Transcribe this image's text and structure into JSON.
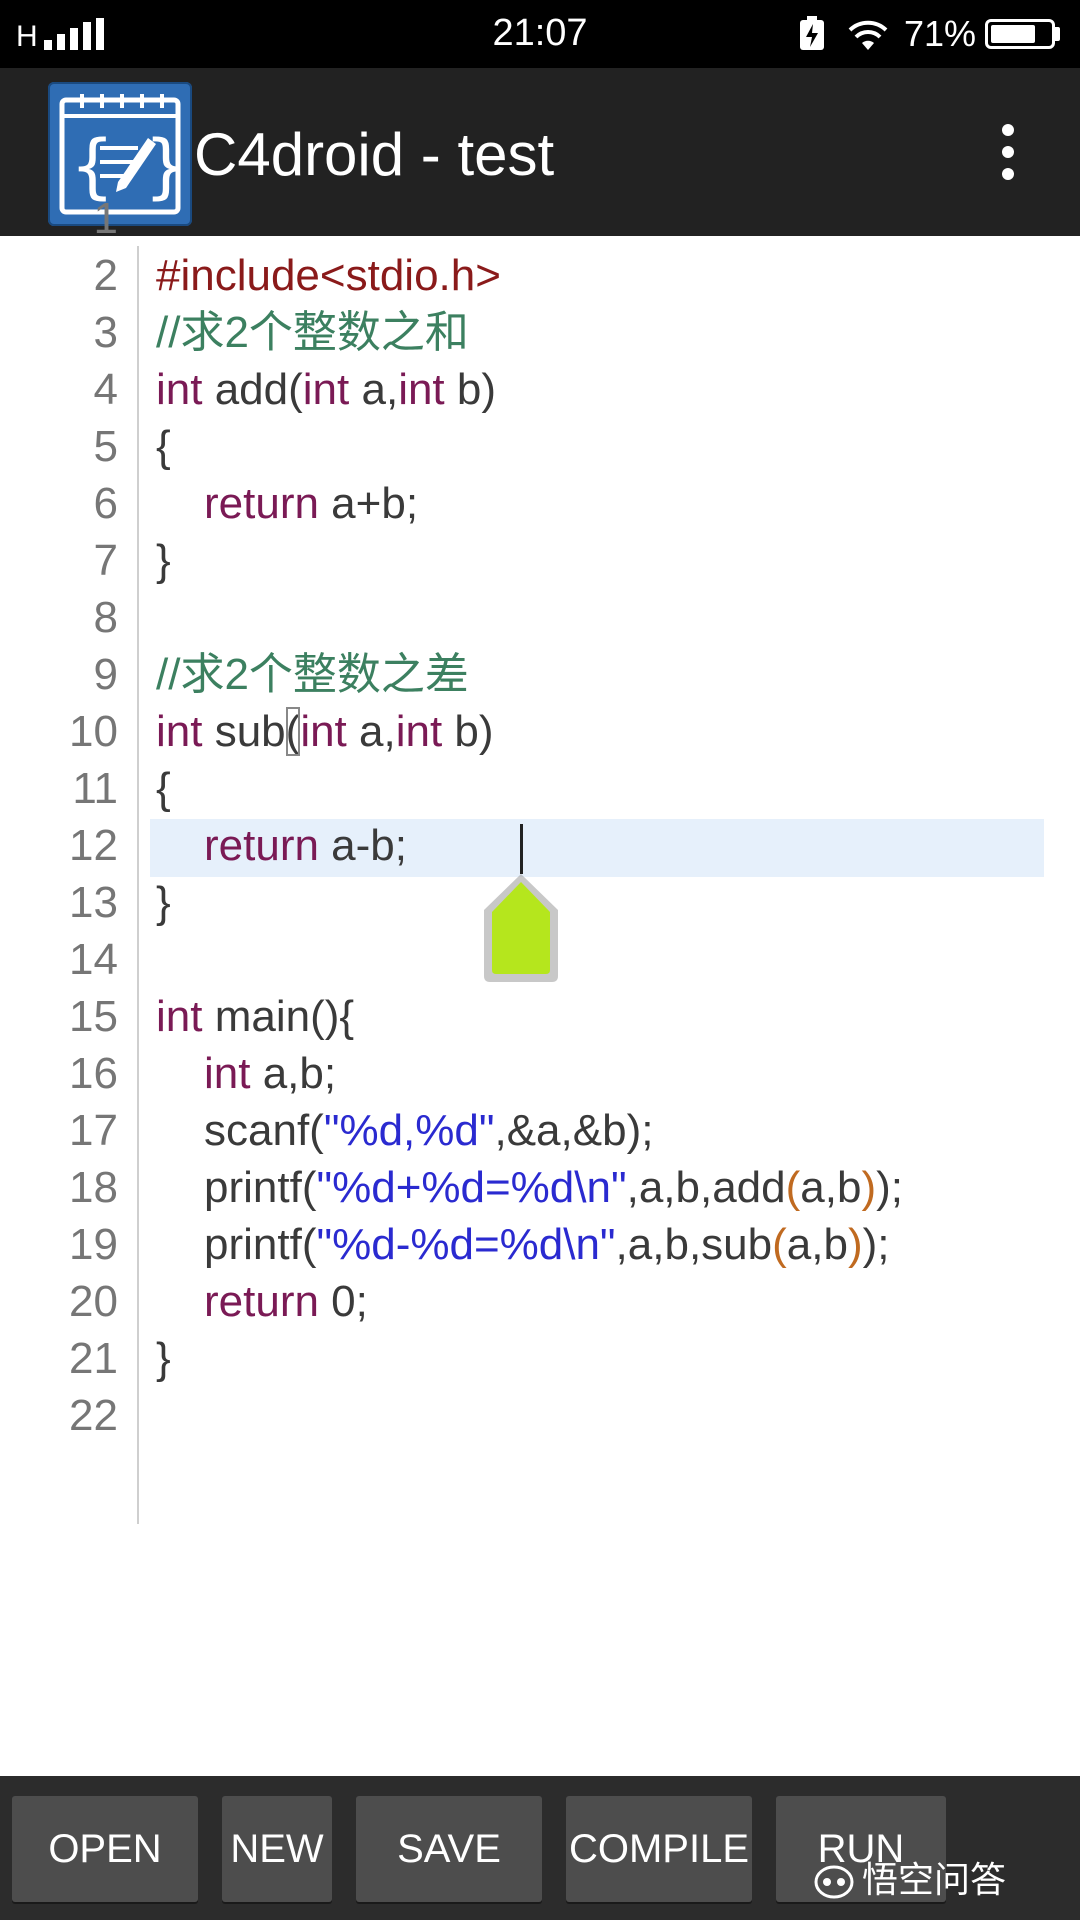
{
  "status_bar": {
    "network": "H",
    "time": "21:07",
    "battery_percent": "71%",
    "battery_level": 0.71
  },
  "app_bar": {
    "title": "C4droid - test",
    "logo_icon": "c4droid-logo-icon",
    "menu_icon": "overflow-menu-icon"
  },
  "editor": {
    "current_line": 11,
    "lines": [
      {
        "n": "1",
        "text": ""
      },
      {
        "n": "2",
        "text": "#include<stdio.h>"
      },
      {
        "n": "3",
        "text": ""
      },
      {
        "n": "4",
        "text": "//求2个整数之和"
      },
      {
        "n": "5",
        "text": "int add(int a,int b)"
      },
      {
        "n": "6",
        "text": "{"
      },
      {
        "n": "7",
        "text": "return a+b;"
      },
      {
        "n": "8",
        "text": "}"
      },
      {
        "n": "9",
        "text": ""
      },
      {
        "n": "10",
        "text": "//求2个整数之差"
      },
      {
        "n": "11",
        "text": "int sub(int a,int b)"
      },
      {
        "n": "12",
        "text": "{"
      },
      {
        "n": "13",
        "text": "return a-b;"
      },
      {
        "n": "14",
        "text": "}"
      },
      {
        "n": "15",
        "text": ""
      },
      {
        "n": "16",
        "text": "int main(){"
      },
      {
        "n": "17",
        "text": "int a,b;"
      },
      {
        "n": "18",
        "text": "scanf(\"%d,%d\",&a,&b);"
      },
      {
        "n": "19",
        "text": "printf(\"%d+%d=%d\\n\",a,b,add(a,b));"
      },
      {
        "n": "20",
        "text": "printf(\"%d-%d=%d\\n\",a,b,sub(a,b));"
      },
      {
        "n": "21",
        "text": "return 0;"
      },
      {
        "n": "22",
        "text": "}"
      }
    ],
    "tokens": {
      "t2": "#include<stdio.h>",
      "t4": "//求2个整数之和",
      "t5_kw1": "int",
      "t5_a": " add(",
      "t5_kw2": "int",
      "t5_b": " a,",
      "t5_kw3": "int",
      "t5_c": " b)",
      "t6": "{",
      "t7_kw": "return",
      "t7_a": " a+b;",
      "t8": "}",
      "t10": "//求2个整数之差",
      "t11_kw1": "int",
      "t11_a": " sub",
      "t11_paren": "(",
      "t11_kw2": "int",
      "t11_b": " a,",
      "t11_kw3": "int",
      "t11_c": " b)",
      "t12": "{",
      "t13_kw": "return",
      "t13_a": " a-b;",
      "t14": "}",
      "t16_kw": "int",
      "t16_a": " main(){",
      "t17_kw": "int",
      "t17_a": " a,b;",
      "t18_a": "scanf(",
      "t18_s": "\"%d,%d\"",
      "t18_b": ",&a,&b);",
      "t19_a": "printf(",
      "t19_s": "\"%d+%d=%d\\n\"",
      "t19_b": ",a,b,add",
      "t19_p1": "(",
      "t19_c": "a,b",
      "t19_p2": ")",
      "t19_d": ");",
      "t20_a": "printf(",
      "t20_s": "\"%d-%d=%d\\n\"",
      "t20_b": ",a,b,sub",
      "t20_p1": "(",
      "t20_c": "a,b",
      "t20_p2": ")",
      "t20_d": ");",
      "t21_kw": "return",
      "t21_a": " 0;",
      "t22": "}"
    }
  },
  "toolbar": {
    "open_label": "OPEN",
    "new_label": "NEW",
    "save_label": "SAVE",
    "compile_label": "COMPILE",
    "run_label": "RUN"
  },
  "watermark": {
    "text": "悟空问答"
  },
  "colors": {
    "keyword": "#7a1a55",
    "preprocessor": "#8a1a1a",
    "comment": "#3c8060",
    "string": "#2a2ad0",
    "operator_paren": "#c06a20",
    "current_line_bg": "#e6f0fb",
    "cursor_handle": "#b5e61d"
  }
}
